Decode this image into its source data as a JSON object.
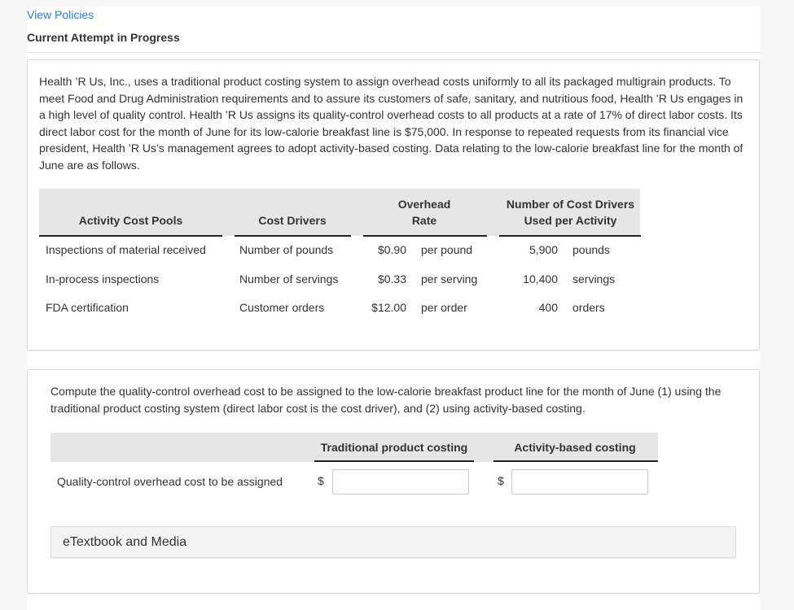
{
  "header": {
    "view_policies": "View Policies",
    "attempt_status": "Current Attempt in Progress"
  },
  "problem": {
    "text": "Health ’R Us, Inc., uses a traditional product costing system to assign overhead costs uniformly to all its packaged multigrain products. To meet Food and Drug Administration requirements and to assure its customers of safe, sanitary, and nutritious food, Health ’R Us engages in a high level of quality control. Health ’R Us assigns its quality-control overhead costs to all products at a rate of 17% of direct labor costs. Its direct labor cost for the month of June for its low-calorie breakfast line is $75,000. In response to repeated requests from its financial vice president, Health ’R Us’s management agrees to adopt activity-based costing. Data relating to the low-calorie breakfast line for the month of June are as follows.",
    "table": {
      "headers": {
        "pools": "Activity Cost Pools",
        "drivers": "Cost Drivers",
        "rate_line1": "Overhead",
        "rate_line2": "Rate",
        "used_line1": "Number of Cost Drivers",
        "used_line2": "Used per Activity"
      },
      "rows": [
        {
          "pool": "Inspections of material received",
          "driver": "Number of pounds",
          "rate": "$0.90",
          "rate_unit": "per pound",
          "used": "5,900",
          "used_unit": "pounds"
        },
        {
          "pool": "In-process inspections",
          "driver": "Number of servings",
          "rate": "$0.33",
          "rate_unit": "per serving",
          "used": "10,400",
          "used_unit": "servings"
        },
        {
          "pool": "FDA certification",
          "driver": "Customer orders",
          "rate": "$12.00",
          "rate_unit": "per order",
          "used": "400",
          "used_unit": "orders"
        }
      ]
    }
  },
  "question": {
    "prompt": "Compute the quality-control overhead cost to be assigned to the low-calorie breakfast product line for the month of June (1) using the traditional product costing system (direct labor cost is the cost driver), and (2) using activity-based costing.",
    "col_traditional": "Traditional product costing",
    "col_abc": "Activity-based costing",
    "row_label": "Quality-control overhead cost to be assigned",
    "currency": "$",
    "traditional_value": "",
    "abc_value": ""
  },
  "resources": {
    "etextbook": "eTextbook and Media"
  }
}
